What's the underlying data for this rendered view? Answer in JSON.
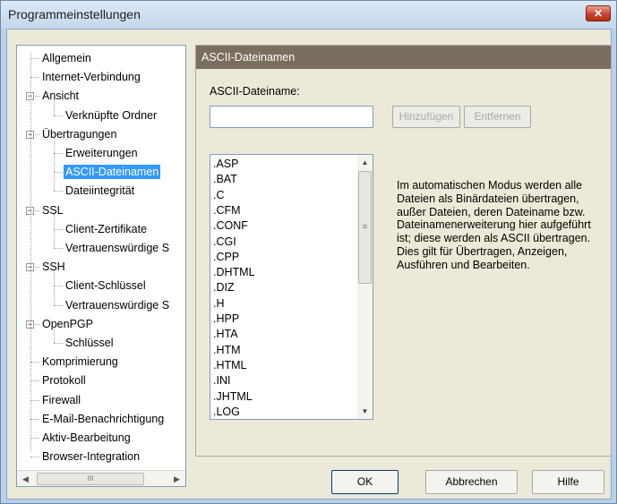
{
  "window": {
    "title": "Programmeinstellungen",
    "close_glyph": "✕"
  },
  "tree": {
    "items": [
      {
        "label": "Allgemein"
      },
      {
        "label": "Internet-Verbindung"
      },
      {
        "label": "Ansicht",
        "expander": "−"
      },
      {
        "label": "Verknüpfte Ordner"
      },
      {
        "label": "Übertragungen",
        "expander": "−"
      },
      {
        "label": "Erweiterungen"
      },
      {
        "label": "ASCII-Dateinamen",
        "selected": true
      },
      {
        "label": "Dateiintegrität"
      },
      {
        "label": "SSL",
        "expander": "−"
      },
      {
        "label": "Client-Zertifikate"
      },
      {
        "label": "Vertrauenswürdige S"
      },
      {
        "label": "SSH",
        "expander": "−"
      },
      {
        "label": "Client-Schlüssel"
      },
      {
        "label": "Vertrauenswürdige S"
      },
      {
        "label": "OpenPGP",
        "expander": "−"
      },
      {
        "label": "Schlüssel"
      },
      {
        "label": "Komprimierung"
      },
      {
        "label": "Protokoll"
      },
      {
        "label": "Firewall"
      },
      {
        "label": "E-Mail-Benachrichtigung"
      },
      {
        "label": "Aktiv-Bearbeitung"
      },
      {
        "label": "Browser-Integration"
      }
    ],
    "scroll_left": "◀",
    "scroll_right": "▶",
    "scroll_thumb": "III"
  },
  "panel": {
    "header": "ASCII-Dateinamen",
    "field_label": "ASCII-Dateiname:",
    "field_value": "",
    "add_button": "Hinzufügen",
    "remove_button": "Entfernen",
    "list": [
      ".ASP",
      ".BAT",
      ".C",
      ".CFM",
      ".CONF",
      ".CGI",
      ".CPP",
      ".DHTML",
      ".DIZ",
      ".H",
      ".HPP",
      ".HTA",
      ".HTM",
      ".HTML",
      ".INI",
      ".JHTML",
      ".LOG"
    ],
    "scroll_up": "▲",
    "scroll_down": "▼",
    "scroll_thumb": "≡",
    "description": "Im automatischen Modus werden alle Dateien als Binärdateien übertragen, außer Dateien, deren Dateiname bzw. Dateinamenerweiterung hier aufgeführt ist; diese werden als ASCII übertragen. Dies gilt für Übertragen, Anzeigen, Ausführen und Bearbeiten."
  },
  "buttons": {
    "ok": "OK",
    "cancel": "Abbrechen",
    "help": "Hilfe"
  }
}
